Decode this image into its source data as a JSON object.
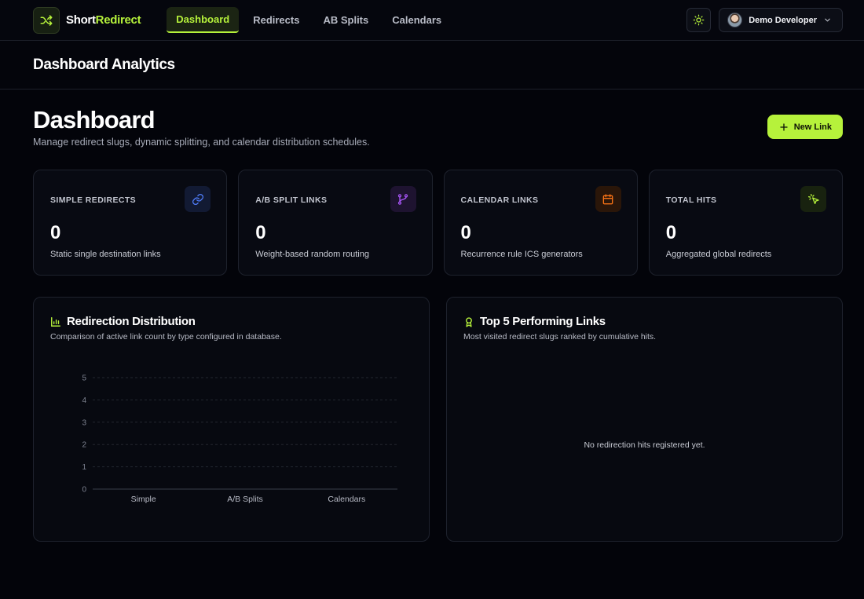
{
  "brand": {
    "name_part1": "Short",
    "name_part2": "Redirect",
    "accent": "#b6f23b"
  },
  "nav": {
    "items": [
      {
        "label": "Dashboard",
        "active": true
      },
      {
        "label": "Redirects",
        "active": false
      },
      {
        "label": "AB Splits",
        "active": false
      },
      {
        "label": "Calendars",
        "active": false
      }
    ]
  },
  "header": {
    "theme_icon": "sun-icon",
    "user_name": "Demo Developer",
    "menu_icon": "chevron-down-icon"
  },
  "subheader": {
    "title": "Dashboard Analytics"
  },
  "page": {
    "title": "Dashboard",
    "subtitle": "Manage redirect slugs, dynamic splitting, and calendar distribution schedules.",
    "new_link_label": "New Link"
  },
  "stats": [
    {
      "label": "SIMPLE REDIRECTS",
      "value": "0",
      "desc": "Static single destination links",
      "icon": "link-icon",
      "color": "#4f7bf7"
    },
    {
      "label": "A/B SPLIT LINKS",
      "value": "0",
      "desc": "Weight-based random routing",
      "icon": "git-branch-icon",
      "color": "#a855f7"
    },
    {
      "label": "CALENDAR LINKS",
      "value": "0",
      "desc": "Recurrence rule ICS generators",
      "icon": "calendar-icon",
      "color": "#f97316"
    },
    {
      "label": "TOTAL HITS",
      "value": "0",
      "desc": "Aggregated global redirects",
      "icon": "cursor-click-icon",
      "color": "#b6f23b"
    }
  ],
  "distribution": {
    "title": "Redirection Distribution",
    "subtitle": "Comparison of active link count by type configured in database."
  },
  "chart_data": {
    "type": "bar",
    "categories": [
      "Simple",
      "A/B Splits",
      "Calendars"
    ],
    "values": [
      0,
      0,
      0
    ],
    "yticks": [
      "0",
      "1",
      "2",
      "3",
      "4",
      "5"
    ],
    "ylim": [
      0,
      5
    ],
    "grid": true
  },
  "top_links": {
    "title": "Top 5 Performing Links",
    "subtitle": "Most visited redirect slugs ranked by cumulative hits.",
    "empty_message": "No redirection hits registered yet."
  }
}
